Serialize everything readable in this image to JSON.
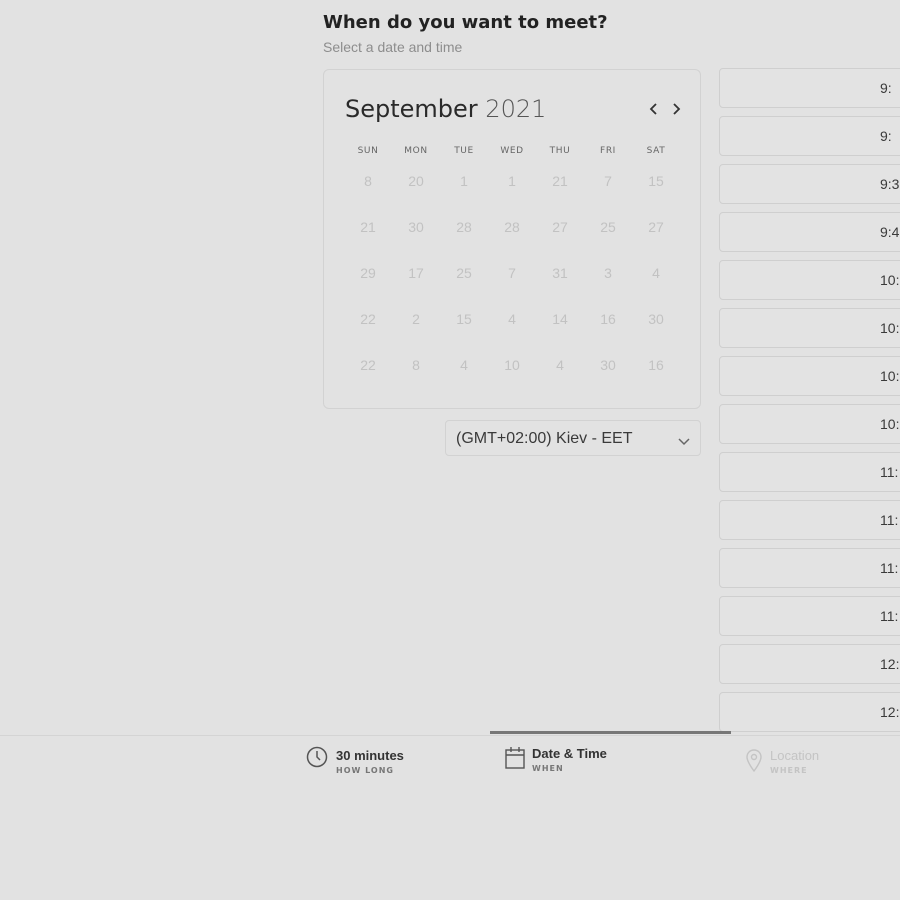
{
  "header": {
    "title": "When do you want to meet?",
    "subtitle": "Select a date and time"
  },
  "calendar": {
    "month": "September",
    "year": "2021",
    "prev_icon": "chevron-left-icon",
    "next_icon": "chevron-right-icon",
    "weekdays": [
      "SUN",
      "MON",
      "TUE",
      "WED",
      "THU",
      "FRI",
      "SAT"
    ],
    "weeks": [
      [
        "8",
        "20",
        "1",
        "1",
        "21",
        "7",
        "15"
      ],
      [
        "21",
        "30",
        "28",
        "28",
        "27",
        "25",
        "27"
      ],
      [
        "29",
        "17",
        "25",
        "7",
        "31",
        "3",
        "4"
      ],
      [
        "22",
        "2",
        "15",
        "4",
        "14",
        "16",
        "30"
      ],
      [
        "22",
        "8",
        "4",
        "10",
        "4",
        "30",
        "16"
      ]
    ]
  },
  "timezone": {
    "label": "(GMT+02:00) Kiev - EET",
    "icon": "chevron-down-icon"
  },
  "time_slots": [
    "9:",
    "9:",
    "9:3",
    "9:4",
    "10:",
    "10:",
    "10:",
    "10:",
    "11:",
    "11:",
    "11:",
    "11:",
    "12:",
    "12:"
  ],
  "footer": {
    "steps": [
      {
        "label": "30 minutes",
        "sub": "HOW LONG",
        "icon": "clock-icon",
        "state": "done"
      },
      {
        "label": "Date & Time",
        "sub": "WHEN",
        "icon": "calendar-icon",
        "state": "active"
      },
      {
        "label": "Location",
        "sub": "WHERE",
        "icon": "location-pin-icon",
        "state": "upcoming"
      }
    ]
  }
}
